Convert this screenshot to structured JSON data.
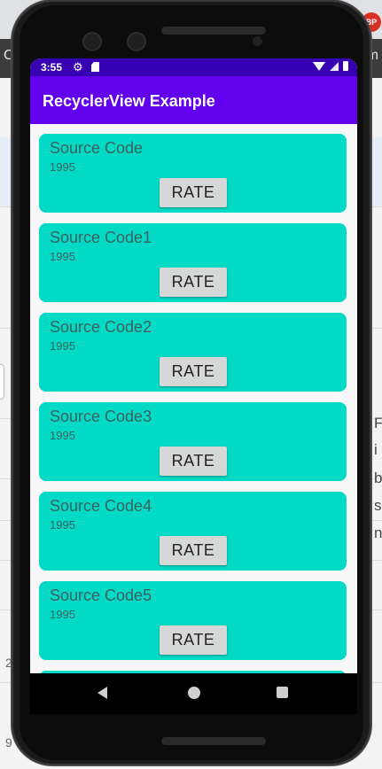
{
  "background": {
    "tab_text_left": "C",
    "tab_text_right": "m",
    "badge_text": "BP",
    "side_letters": [
      "F",
      "i",
      "b",
      "s",
      "n"
    ],
    "left_numbers": [
      "2",
      "9"
    ]
  },
  "status_bar": {
    "time": "3:55",
    "icons": [
      "gear-icon",
      "sd-card-icon",
      "wifi-icon",
      "signal-icon",
      "battery-icon"
    ]
  },
  "app_bar": {
    "title": "RecyclerView Example"
  },
  "list": {
    "items": [
      {
        "title": "Source Code",
        "year": "1995",
        "button": "RATE"
      },
      {
        "title": "Source Code1",
        "year": "1995",
        "button": "RATE"
      },
      {
        "title": "Source Code2",
        "year": "1995",
        "button": "RATE"
      },
      {
        "title": "Source Code3",
        "year": "1995",
        "button": "RATE"
      },
      {
        "title": "Source Code4",
        "year": "1995",
        "button": "RATE"
      },
      {
        "title": "Source Code5",
        "year": "1995",
        "button": "RATE"
      }
    ]
  },
  "navigation": {
    "buttons": [
      "back-icon",
      "home-icon",
      "recents-icon"
    ]
  },
  "colors": {
    "status_bar": "#3700b3",
    "app_bar": "#6200ee",
    "card": "#03dac5",
    "button": "#d6d7d7"
  }
}
